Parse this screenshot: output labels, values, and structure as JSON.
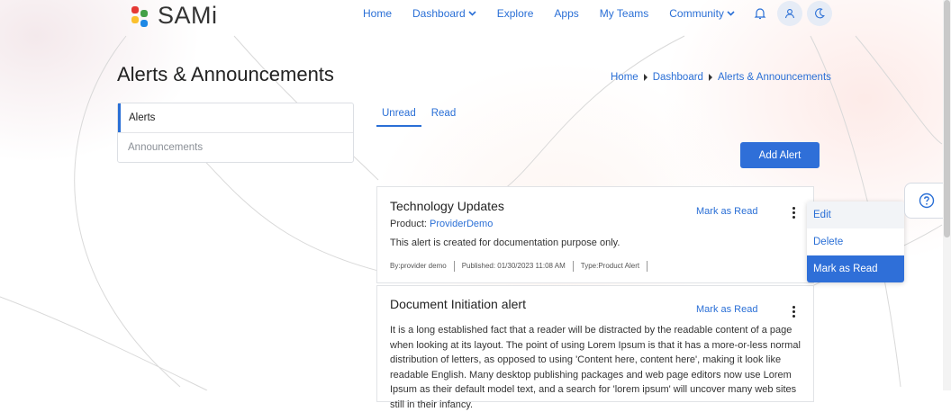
{
  "brand": {
    "name": "SAMi",
    "logo_colors": [
      "#e53935",
      "#43a047",
      "#fbc02d",
      "#1e88e5"
    ]
  },
  "nav": {
    "items": [
      {
        "label": "Home"
      },
      {
        "label": "Dashboard"
      },
      {
        "label": "Explore"
      },
      {
        "label": "Apps"
      },
      {
        "label": "My Teams"
      },
      {
        "label": "Community"
      }
    ],
    "icons": [
      "bell-icon",
      "user-icon",
      "moon-icon"
    ]
  },
  "page": {
    "title": "Alerts & Announcements"
  },
  "breadcrumb": [
    "Home",
    "Dashboard",
    "Alerts & Announcements"
  ],
  "side_menu": {
    "items": [
      {
        "label": "Alerts"
      },
      {
        "label": "Announcements"
      }
    ]
  },
  "tabs": [
    {
      "label": "Unread"
    },
    {
      "label": "Read"
    }
  ],
  "add_button": {
    "label": "Add Alert"
  },
  "alerts": [
    {
      "title": "Technology Updates",
      "action": "Mark as Read",
      "product_label": "Product:",
      "product": "ProviderDemo",
      "description": "This alert is created for documentation purpose only.",
      "by": "By:provider demo",
      "published": "Published: 01/30/2023 11:08 AM",
      "type": "Type:Product Alert"
    },
    {
      "title": "Document Initiation alert",
      "action": "Mark as Read",
      "body": "It is a long established fact that a reader will be distracted by the readable content of a page when looking at its layout. The point of using Lorem Ipsum is that it has a more-or-less normal distribution of letters, as opposed to using 'Content here, content here', making it look like readable English. Many desktop publishing packages and web page editors now use Lorem Ipsum as their default model text, and a search for 'lorem ipsum' will uncover many web sites still in their infancy."
    }
  ],
  "dropdown": {
    "items": [
      {
        "label": "Edit"
      },
      {
        "label": "Delete"
      },
      {
        "label": "Mark as Read"
      }
    ]
  },
  "colors": {
    "accent": "#2f6fd8",
    "link": "#2a6fd6"
  },
  "help": {
    "icon": "help-icon"
  }
}
